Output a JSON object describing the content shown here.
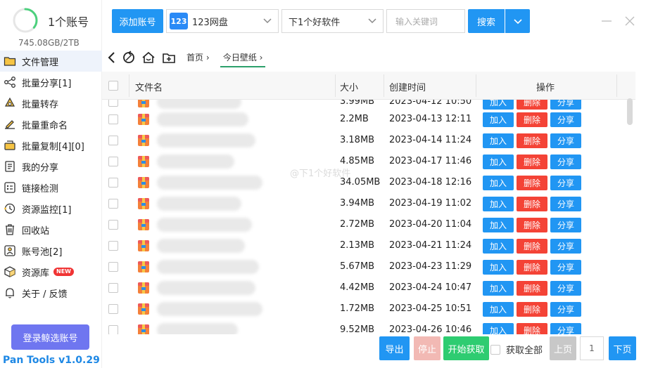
{
  "account": {
    "name": "1个账号",
    "storage": "745.08GB/2TB",
    "usage_fraction": 0.36,
    "ring_color": "#4cd07d"
  },
  "sidebar": {
    "items": [
      {
        "label": "文件管理",
        "icon": "folder-icon",
        "active": true
      },
      {
        "label": "批量分享[1]",
        "icon": "share-nodes-icon"
      },
      {
        "label": "批量转存",
        "icon": "recycle-transfer-icon"
      },
      {
        "label": "批量重命名",
        "icon": "edit-pen-icon"
      },
      {
        "label": "批量复制[4][0]",
        "icon": "copy-box-icon"
      },
      {
        "label": "我的分享",
        "icon": "my-share-doc-icon"
      },
      {
        "label": "链接检测",
        "icon": "link-check-icon"
      },
      {
        "label": "资源监控[1]",
        "icon": "monitor-clock-icon"
      },
      {
        "label": "回收站",
        "icon": "trash-icon"
      },
      {
        "label": "账号池[2]",
        "icon": "account-pool-icon"
      },
      {
        "label": "资源库",
        "icon": "resource-box-icon",
        "badge": "NEW"
      },
      {
        "label": "关于 / 反馈",
        "icon": "bell-icon"
      }
    ],
    "login_button": "登录鲸选账号",
    "version": "Pan Tools v1.0.29"
  },
  "topbar": {
    "add_account": "添加账号",
    "drive_select": {
      "icon_text": "123",
      "value": "123网盘"
    },
    "site_select": {
      "value": "下1个好软件"
    },
    "search_placeholder": "输入关键词",
    "search_button": "搜索"
  },
  "breadcrumb": {
    "items": [
      "首页",
      "今日壁纸"
    ]
  },
  "table": {
    "headers": {
      "name": "文件名",
      "size": "大小",
      "created": "创建时间",
      "ops": "操作"
    },
    "actions": {
      "add": "加入",
      "delete": "删除",
      "share": "分享"
    },
    "rows": [
      {
        "size": "3.99MB",
        "date": "2023-04-12 10:50",
        "partial": true
      },
      {
        "size": "2.2MB",
        "date": "2023-04-13 12:11"
      },
      {
        "size": "3.18MB",
        "date": "2023-04-14 11:24"
      },
      {
        "size": "4.85MB",
        "date": "2023-04-17 11:46"
      },
      {
        "size": "34.05MB",
        "date": "2023-04-18 12:16"
      },
      {
        "size": "3.94MB",
        "date": "2023-04-19 11:02"
      },
      {
        "size": "2.72MB",
        "date": "2023-04-20 11:04"
      },
      {
        "size": "2.13MB",
        "date": "2023-04-21 11:24"
      },
      {
        "size": "5.67MB",
        "date": "2023-04-23 11:29"
      },
      {
        "size": "4.42MB",
        "date": "2023-04-24 10:47"
      },
      {
        "size": "1.72MB",
        "date": "2023-04-25 10:51"
      },
      {
        "size": "9.52MB",
        "date": "2023-04-26 10:46"
      }
    ]
  },
  "watermark": "@下1个好软件",
  "bottombar": {
    "export": "导出",
    "stop": "停止",
    "start_fetch": "开始获取",
    "fetch_all": "获取全部",
    "prev": "上页",
    "page": "1",
    "next": "下页"
  },
  "colors": {
    "primary": "#2196f3",
    "danger": "#f44336",
    "success": "#2ecc71",
    "login": "#6f76f0",
    "version": "#1e88e5"
  }
}
